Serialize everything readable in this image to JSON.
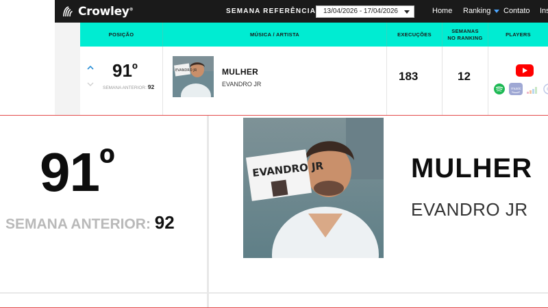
{
  "brand": {
    "name": "Crowley",
    "reg": "®"
  },
  "header": {
    "reference_label": "SEMANA REFERÊNCIA:",
    "date_range": "13/04/2026 - 17/04/2026",
    "nav": {
      "home": "Home",
      "ranking": "Ranking",
      "contact": "Contato",
      "partial": "Ins"
    }
  },
  "table": {
    "columns": {
      "position": "POSIÇÃO",
      "song_artist": "MÚSICA / ARTISTA",
      "plays": "EXECUÇÕES",
      "weeks_line1": "SEMANAS",
      "weeks_line2": "NO RANKING",
      "players": "PLAYERS"
    },
    "row": {
      "position": "91",
      "degree": "º",
      "previous_label": "SEMANA ANTERIOR:",
      "previous_value": "92",
      "title": "MULHER",
      "artist": "EVANDRO JR",
      "plays": "183",
      "weeks": "12",
      "thumb_text": "EVANDRO JR",
      "players": [
        "youtube-icon",
        "spotify-icon",
        "amazon-music-icon",
        "deezer-icon",
        "other-player-icon"
      ]
    }
  },
  "zoom": {
    "position": "91",
    "degree": "º",
    "previous_label": "SEMANA ANTERIOR:",
    "previous_value": "92",
    "title": "MULHER",
    "artist": "EVANDRO JR"
  },
  "colors": {
    "header_bg": "#1a1a1a",
    "table_head_bg": "#00ecd2",
    "youtube": "#ff0000",
    "spotify": "#1db954",
    "amazon": "#9fa8d4",
    "zoom_border": "#e34a4a"
  }
}
